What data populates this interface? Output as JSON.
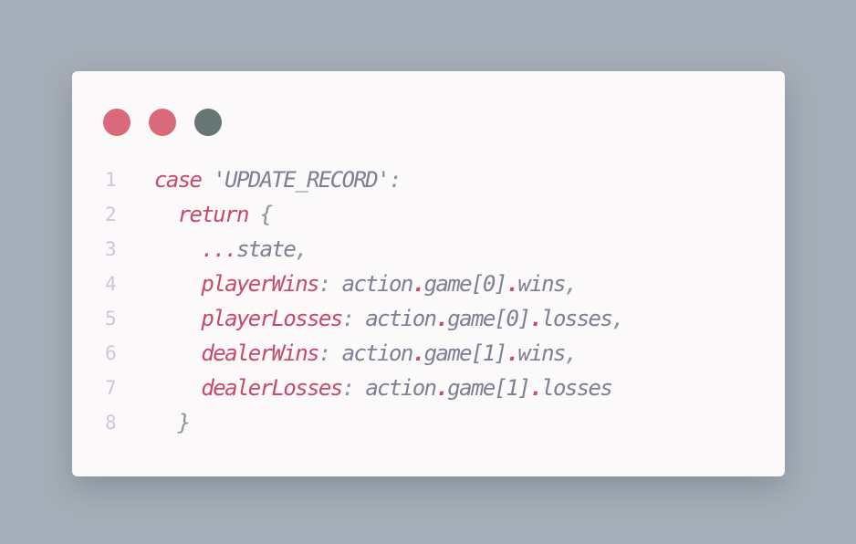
{
  "window": {
    "title_dots": [
      {
        "name": "close",
        "color": "#d86a7c"
      },
      {
        "name": "minimize",
        "color": "#d86a7c"
      },
      {
        "name": "maximize",
        "color": "#667675"
      }
    ]
  },
  "colors": {
    "keyword": "#c84a6a",
    "string": "#7d7f93",
    "property": "#c84a6a",
    "text": "#7d7f93",
    "punct": "#8e9099",
    "dot": "#c84a6a",
    "line_number": "#d2c3da"
  },
  "code": {
    "lines": [
      {
        "number": "1",
        "indent": "",
        "tokens": [
          {
            "t": "case",
            "c": "keyword"
          },
          {
            "t": " ",
            "c": "text"
          },
          {
            "t": "'UPDATE_RECORD'",
            "c": "string"
          },
          {
            "t": ":",
            "c": "punct"
          }
        ]
      },
      {
        "number": "2",
        "indent": "  ",
        "tokens": [
          {
            "t": "return",
            "c": "keyword"
          },
          {
            "t": " ",
            "c": "text"
          },
          {
            "t": "{",
            "c": "punct"
          }
        ]
      },
      {
        "number": "3",
        "indent": "    ",
        "tokens": [
          {
            "t": "...",
            "c": "keyword"
          },
          {
            "t": "state",
            "c": "text"
          },
          {
            "t": ",",
            "c": "punct"
          }
        ]
      },
      {
        "number": "4",
        "indent": "    ",
        "tokens": [
          {
            "t": "playerWins",
            "c": "property"
          },
          {
            "t": ": ",
            "c": "punct"
          },
          {
            "t": "action",
            "c": "text"
          },
          {
            "t": ".",
            "c": "dot"
          },
          {
            "t": "game[0]",
            "c": "text"
          },
          {
            "t": ".",
            "c": "dot"
          },
          {
            "t": "wins",
            "c": "text"
          },
          {
            "t": ",",
            "c": "punct"
          }
        ]
      },
      {
        "number": "5",
        "indent": "    ",
        "tokens": [
          {
            "t": "playerLosses",
            "c": "property"
          },
          {
            "t": ": ",
            "c": "punct"
          },
          {
            "t": "action",
            "c": "text"
          },
          {
            "t": ".",
            "c": "dot"
          },
          {
            "t": "game[0]",
            "c": "text"
          },
          {
            "t": ".",
            "c": "dot"
          },
          {
            "t": "losses",
            "c": "text"
          },
          {
            "t": ",",
            "c": "punct"
          }
        ]
      },
      {
        "number": "6",
        "indent": "    ",
        "tokens": [
          {
            "t": "dealerWins",
            "c": "property"
          },
          {
            "t": ": ",
            "c": "punct"
          },
          {
            "t": "action",
            "c": "text"
          },
          {
            "t": ".",
            "c": "dot"
          },
          {
            "t": "game[1]",
            "c": "text"
          },
          {
            "t": ".",
            "c": "dot"
          },
          {
            "t": "wins",
            "c": "text"
          },
          {
            "t": ",",
            "c": "punct"
          }
        ]
      },
      {
        "number": "7",
        "indent": "    ",
        "tokens": [
          {
            "t": "dealerLosses",
            "c": "property"
          },
          {
            "t": ": ",
            "c": "punct"
          },
          {
            "t": "action",
            "c": "text"
          },
          {
            "t": ".",
            "c": "dot"
          },
          {
            "t": "game[1]",
            "c": "text"
          },
          {
            "t": ".",
            "c": "dot"
          },
          {
            "t": "losses",
            "c": "text"
          }
        ]
      },
      {
        "number": "8",
        "indent": "  ",
        "tokens": [
          {
            "t": "}",
            "c": "punct"
          }
        ]
      }
    ]
  }
}
